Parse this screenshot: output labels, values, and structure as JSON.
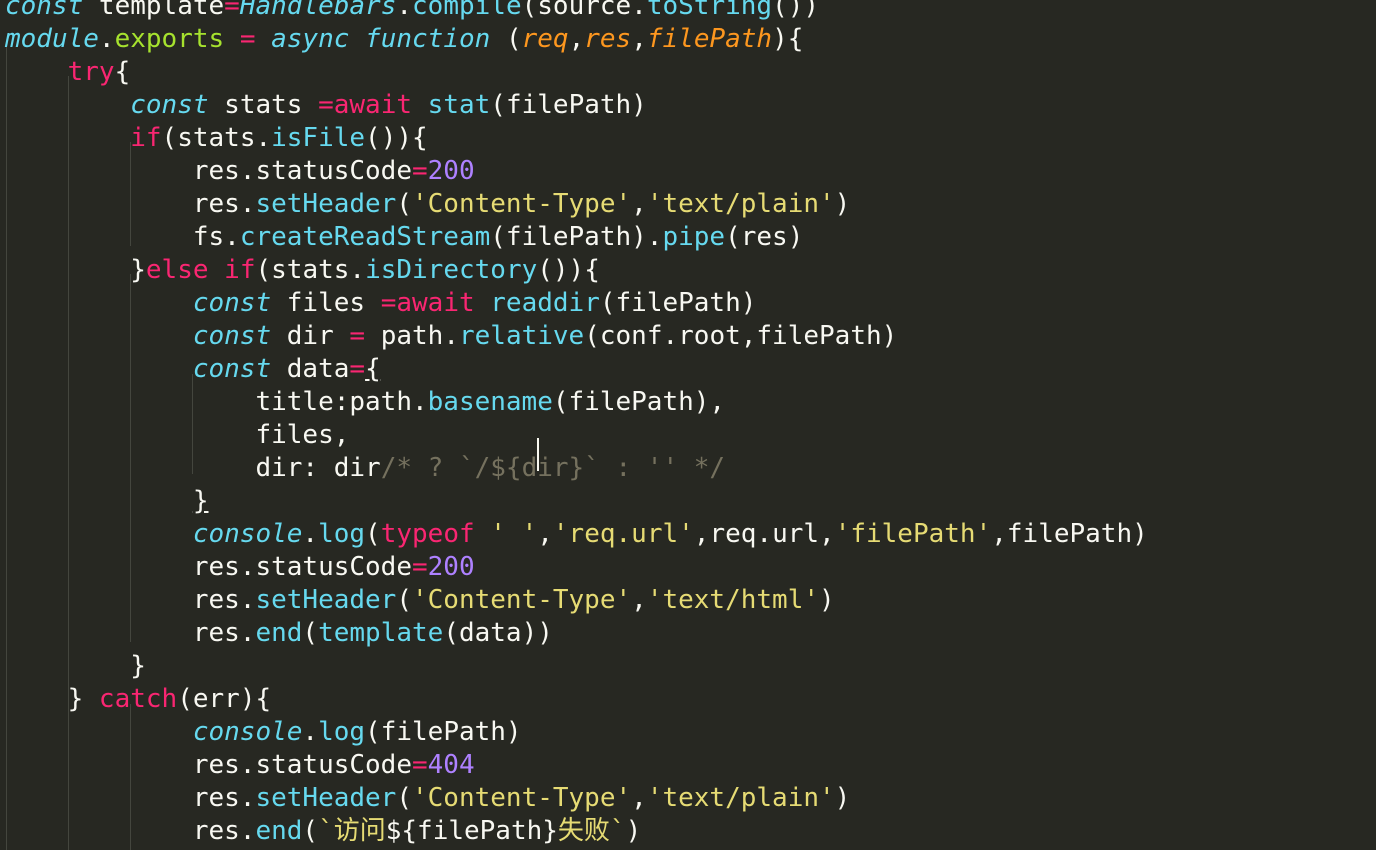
{
  "editor": {
    "theme_colors": {
      "background": "#272822",
      "foreground": "#f8f8f2",
      "keyword": "#f92672",
      "storage": "#66d9ef",
      "support": "#66d9ef",
      "export_name": "#a6e22e",
      "parameter": "#fd971f",
      "string": "#e6db74",
      "number": "#ae81ff",
      "comment": "#75715e"
    },
    "lines": [
      [
        {
          "t": "const",
          "c": "st"
        },
        {
          "t": " template",
          "c": "pl"
        },
        {
          "t": "=",
          "c": "kw"
        },
        {
          "t": "Handlebars",
          "c": "st"
        },
        {
          "t": ".",
          "c": "pl"
        },
        {
          "t": "compile",
          "c": "fn"
        },
        {
          "t": "(source.",
          "c": "pl"
        },
        {
          "t": "toString",
          "c": "fn"
        },
        {
          "t": "())",
          "c": "pl"
        }
      ],
      [
        {
          "t": "module",
          "c": "st"
        },
        {
          "t": ".",
          "c": "pl"
        },
        {
          "t": "exports",
          "c": "ex"
        },
        {
          "t": " ",
          "c": "pl"
        },
        {
          "t": "=",
          "c": "kw"
        },
        {
          "t": " ",
          "c": "pl"
        },
        {
          "t": "async",
          "c": "st"
        },
        {
          "t": " ",
          "c": "pl"
        },
        {
          "t": "function",
          "c": "st"
        },
        {
          "t": " (",
          "c": "pl"
        },
        {
          "t": "req",
          "c": "par"
        },
        {
          "t": ",",
          "c": "pl"
        },
        {
          "t": "res",
          "c": "par"
        },
        {
          "t": ",",
          "c": "pl"
        },
        {
          "t": "filePath",
          "c": "par"
        },
        {
          "t": "){",
          "c": "pl"
        }
      ],
      [
        {
          "t": "    ",
          "c": "pl"
        },
        {
          "t": "try",
          "c": "kw"
        },
        {
          "t": "{",
          "c": "pl"
        }
      ],
      [
        {
          "t": "        ",
          "c": "pl"
        },
        {
          "t": "const",
          "c": "st"
        },
        {
          "t": " stats ",
          "c": "pl"
        },
        {
          "t": "=await",
          "c": "kw"
        },
        {
          "t": " ",
          "c": "pl"
        },
        {
          "t": "stat",
          "c": "fn"
        },
        {
          "t": "(filePath)",
          "c": "pl"
        }
      ],
      [
        {
          "t": "        ",
          "c": "pl"
        },
        {
          "t": "if",
          "c": "kw"
        },
        {
          "t": "(stats.",
          "c": "pl"
        },
        {
          "t": "isFile",
          "c": "fn"
        },
        {
          "t": "()){",
          "c": "pl"
        }
      ],
      [
        {
          "t": "            res.statusCode",
          "c": "pl"
        },
        {
          "t": "=",
          "c": "kw"
        },
        {
          "t": "200",
          "c": "num"
        }
      ],
      [
        {
          "t": "            res.",
          "c": "pl"
        },
        {
          "t": "setHeader",
          "c": "fn"
        },
        {
          "t": "(",
          "c": "pl"
        },
        {
          "t": "'Content-Type'",
          "c": "str"
        },
        {
          "t": ",",
          "c": "pl"
        },
        {
          "t": "'text/plain'",
          "c": "str"
        },
        {
          "t": ")",
          "c": "pl"
        }
      ],
      [
        {
          "t": "            fs.",
          "c": "pl"
        },
        {
          "t": "createReadStream",
          "c": "fn"
        },
        {
          "t": "(filePath).",
          "c": "pl"
        },
        {
          "t": "pipe",
          "c": "fn"
        },
        {
          "t": "(res)",
          "c": "pl"
        }
      ],
      [
        {
          "t": "        }",
          "c": "pl"
        },
        {
          "t": "else",
          "c": "kw"
        },
        {
          "t": " ",
          "c": "pl"
        },
        {
          "t": "if",
          "c": "kw"
        },
        {
          "t": "(stats.",
          "c": "pl"
        },
        {
          "t": "isDirectory",
          "c": "fn"
        },
        {
          "t": "()){",
          "c": "pl"
        }
      ],
      [
        {
          "t": "            ",
          "c": "pl"
        },
        {
          "t": "const",
          "c": "st"
        },
        {
          "t": " files ",
          "c": "pl"
        },
        {
          "t": "=await",
          "c": "kw"
        },
        {
          "t": " ",
          "c": "pl"
        },
        {
          "t": "readdir",
          "c": "fn"
        },
        {
          "t": "(filePath)",
          "c": "pl"
        }
      ],
      [
        {
          "t": "            ",
          "c": "pl"
        },
        {
          "t": "const",
          "c": "st"
        },
        {
          "t": " dir ",
          "c": "pl"
        },
        {
          "t": "=",
          "c": "kw"
        },
        {
          "t": " path.",
          "c": "pl"
        },
        {
          "t": "relative",
          "c": "fn"
        },
        {
          "t": "(conf.root,filePath)",
          "c": "pl"
        }
      ],
      [
        {
          "t": "            ",
          "c": "pl"
        },
        {
          "t": "const",
          "c": "st"
        },
        {
          "t": " data",
          "c": "pl"
        },
        {
          "t": "=",
          "c": "kw"
        },
        {
          "t": "{",
          "c": "pl",
          "u": true
        }
      ],
      [
        {
          "t": "                title:path.",
          "c": "pl"
        },
        {
          "t": "basename",
          "c": "fn"
        },
        {
          "t": "(filePath),",
          "c": "pl"
        }
      ],
      [
        {
          "t": "                files,",
          "c": "pl"
        }
      ],
      [
        {
          "t": "                dir: dir",
          "c": "pl"
        },
        {
          "t": "/* ? `/${dir}` : '' */",
          "c": "cmt"
        }
      ],
      [
        {
          "t": "            ",
          "c": "pl"
        },
        {
          "t": "}",
          "c": "pl",
          "u": true
        }
      ],
      [
        {
          "t": "            ",
          "c": "pl"
        },
        {
          "t": "console",
          "c": "st"
        },
        {
          "t": ".",
          "c": "pl"
        },
        {
          "t": "log",
          "c": "fn"
        },
        {
          "t": "(",
          "c": "pl"
        },
        {
          "t": "typeof",
          "c": "kw"
        },
        {
          "t": " ",
          "c": "pl"
        },
        {
          "t": "' '",
          "c": "str"
        },
        {
          "t": ",",
          "c": "pl"
        },
        {
          "t": "'req.url'",
          "c": "str"
        },
        {
          "t": ",req.url,",
          "c": "pl"
        },
        {
          "t": "'filePath'",
          "c": "str"
        },
        {
          "t": ",filePath)",
          "c": "pl"
        }
      ],
      [
        {
          "t": "            res.statusCode",
          "c": "pl"
        },
        {
          "t": "=",
          "c": "kw"
        },
        {
          "t": "200",
          "c": "num"
        }
      ],
      [
        {
          "t": "            res.",
          "c": "pl"
        },
        {
          "t": "setHeader",
          "c": "fn"
        },
        {
          "t": "(",
          "c": "pl"
        },
        {
          "t": "'Content-Type'",
          "c": "str"
        },
        {
          "t": ",",
          "c": "pl"
        },
        {
          "t": "'text/html'",
          "c": "str"
        },
        {
          "t": ")",
          "c": "pl"
        }
      ],
      [
        {
          "t": "            res.",
          "c": "pl"
        },
        {
          "t": "end",
          "c": "fn"
        },
        {
          "t": "(",
          "c": "pl"
        },
        {
          "t": "template",
          "c": "fn"
        },
        {
          "t": "(data))",
          "c": "pl"
        }
      ],
      [
        {
          "t": "        }",
          "c": "pl"
        }
      ],
      [
        {
          "t": "    } ",
          "c": "pl"
        },
        {
          "t": "catch",
          "c": "kw"
        },
        {
          "t": "(err){",
          "c": "pl"
        }
      ],
      [
        {
          "t": "            ",
          "c": "pl"
        },
        {
          "t": "console",
          "c": "st"
        },
        {
          "t": ".",
          "c": "pl"
        },
        {
          "t": "log",
          "c": "fn"
        },
        {
          "t": "(filePath)",
          "c": "pl"
        }
      ],
      [
        {
          "t": "            res.statusCode",
          "c": "pl"
        },
        {
          "t": "=",
          "c": "kw"
        },
        {
          "t": "404",
          "c": "num"
        }
      ],
      [
        {
          "t": "            res.",
          "c": "pl"
        },
        {
          "t": "setHeader",
          "c": "fn"
        },
        {
          "t": "(",
          "c": "pl"
        },
        {
          "t": "'Content-Type'",
          "c": "str"
        },
        {
          "t": ",",
          "c": "pl"
        },
        {
          "t": "'text/plain'",
          "c": "str"
        },
        {
          "t": ")",
          "c": "pl"
        }
      ],
      [
        {
          "t": "            res.",
          "c": "pl"
        },
        {
          "t": "end",
          "c": "fn"
        },
        {
          "t": "(",
          "c": "pl"
        },
        {
          "t": "`访问",
          "c": "str"
        },
        {
          "t": "${filePath}",
          "c": "pl"
        },
        {
          "t": "失败`",
          "c": "str"
        },
        {
          "t": ")",
          "c": "pl"
        }
      ]
    ]
  }
}
